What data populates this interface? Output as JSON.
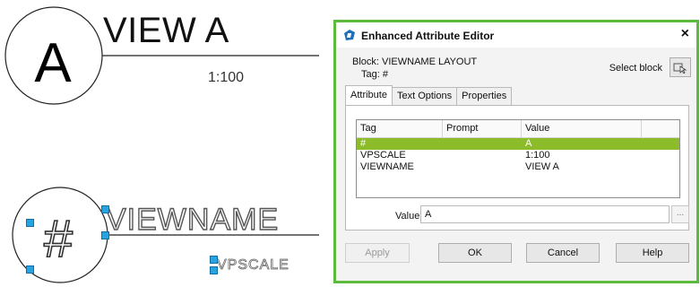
{
  "drawing": {
    "view_title": "VIEW A",
    "view_scale": "1:100",
    "bubble_letter": "A",
    "template_title": "VIEWNAME",
    "template_scale": "VPSCALE",
    "template_hash": "#"
  },
  "dialog": {
    "title": "Enhanced Attribute Editor",
    "block_line": "Block: VIEWNAME LAYOUT",
    "tag_line": "Tag: #",
    "select_block_label": "Select block",
    "tabs": [
      {
        "label": "Attribute",
        "active": true
      },
      {
        "label": "Text Options",
        "active": false
      },
      {
        "label": "Properties",
        "active": false
      }
    ],
    "columns": [
      "Tag",
      "Prompt",
      "Value"
    ],
    "rows": [
      {
        "tag": "#",
        "prompt": "",
        "value": "A",
        "selected": true
      },
      {
        "tag": "VPSCALE",
        "prompt": "",
        "value": "1:100",
        "selected": false
      },
      {
        "tag": "VIEWNAME",
        "prompt": "",
        "value": "VIEW A",
        "selected": false
      }
    ],
    "value_label": "Value:",
    "value_field": "A",
    "ellipsis": "...",
    "buttons": {
      "apply": "Apply",
      "ok": "OK",
      "cancel": "Cancel",
      "help": "Help"
    },
    "accent_color": "#8cbc2a",
    "border_color": "#5cba3c"
  }
}
